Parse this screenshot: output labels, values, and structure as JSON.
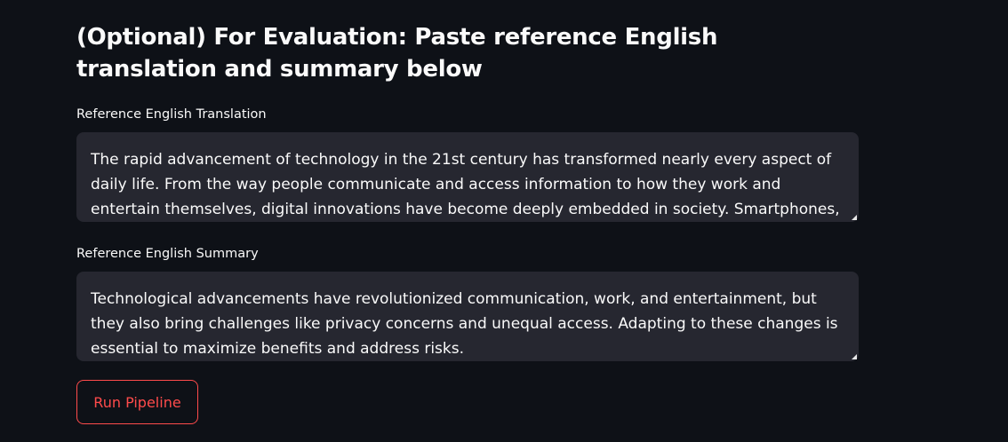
{
  "evaluation_section": {
    "heading": "(Optional) For Evaluation: Paste reference English translation and summary below",
    "translation_field": {
      "label": "Reference English Translation",
      "value": "The rapid advancement of technology in the 21st century has transformed nearly every aspect of daily life. From the way people communicate and access information to how they work and entertain themselves, digital innovations have become deeply embedded in society. Smartphones, high-speed"
    },
    "summary_field": {
      "label": "Reference English Summary",
      "value": "Technological advancements have revolutionized communication, work, and entertainment, but they also bring challenges like privacy concerns and unequal access. Adapting to these changes is essential to maximize benefits and address risks."
    }
  },
  "actions": {
    "run_pipeline_label": "Run Pipeline"
  },
  "theme": {
    "background": "#0e1117",
    "input_background": "#262730",
    "text": "#fafafa",
    "accent": "#ff4b4b"
  }
}
